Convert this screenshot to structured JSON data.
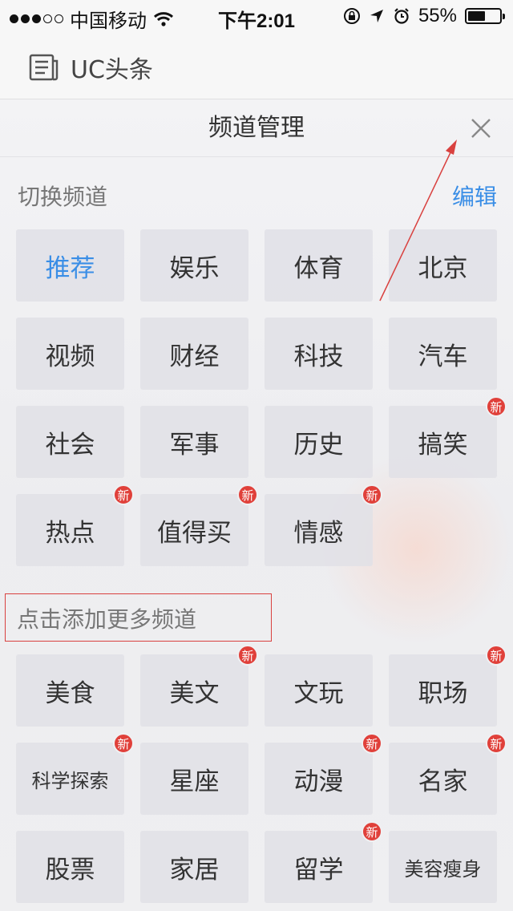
{
  "status_bar": {
    "carrier": "中国移动",
    "time": "下午2:01",
    "battery": "55%",
    "battery_level": 0.55
  },
  "app": {
    "title": "UC头条"
  },
  "panel": {
    "title": "频道管理",
    "switch_label": "切换频道",
    "edit_label": "编辑",
    "add_label": "点击添加更多频道",
    "badge_text": "新",
    "my_channels": [
      {
        "name": "推荐",
        "active": true,
        "badge": false
      },
      {
        "name": "娱乐",
        "active": false,
        "badge": false
      },
      {
        "name": "体育",
        "active": false,
        "badge": false
      },
      {
        "name": "北京",
        "active": false,
        "badge": false
      },
      {
        "name": "视频",
        "active": false,
        "badge": false
      },
      {
        "name": "财经",
        "active": false,
        "badge": false
      },
      {
        "name": "科技",
        "active": false,
        "badge": false
      },
      {
        "name": "汽车",
        "active": false,
        "badge": false
      },
      {
        "name": "社会",
        "active": false,
        "badge": false
      },
      {
        "name": "军事",
        "active": false,
        "badge": false
      },
      {
        "name": "历史",
        "active": false,
        "badge": false
      },
      {
        "name": "搞笑",
        "active": false,
        "badge": true
      },
      {
        "name": "热点",
        "active": false,
        "badge": true
      },
      {
        "name": "值得买",
        "active": false,
        "badge": true
      },
      {
        "name": "情感",
        "active": false,
        "badge": true
      }
    ],
    "more_channels": [
      {
        "name": "美食",
        "badge": false
      },
      {
        "name": "美文",
        "badge": true
      },
      {
        "name": "文玩",
        "badge": false
      },
      {
        "name": "职场",
        "badge": true
      },
      {
        "name": "科学探索",
        "badge": true
      },
      {
        "name": "星座",
        "badge": false
      },
      {
        "name": "动漫",
        "badge": true
      },
      {
        "name": "名家",
        "badge": true
      },
      {
        "name": "股票",
        "badge": false
      },
      {
        "name": "家居",
        "badge": false
      },
      {
        "name": "留学",
        "badge": true
      },
      {
        "name": "美容瘦身",
        "badge": false
      }
    ]
  },
  "colors": {
    "accent": "#3a8ee6",
    "badge": "#e0403a",
    "annotation": "#d9413f"
  }
}
